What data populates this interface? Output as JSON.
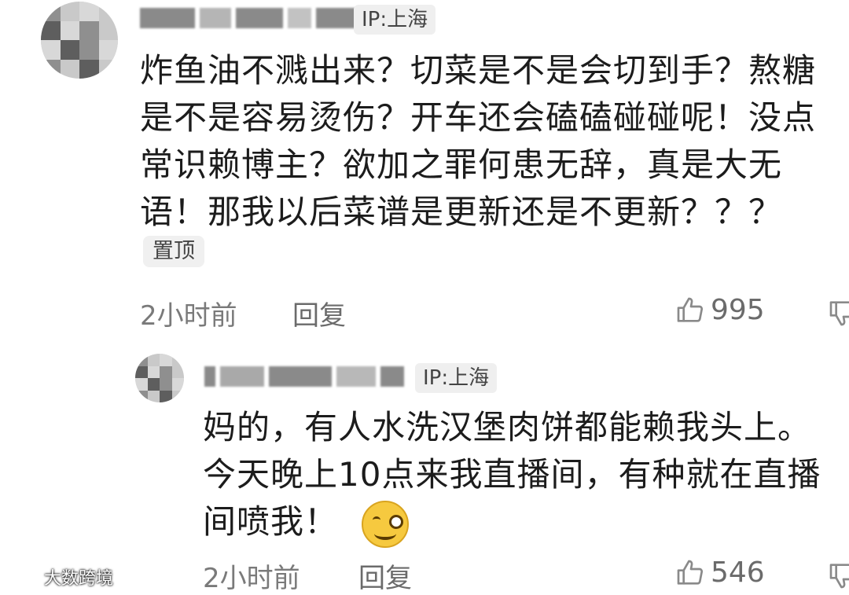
{
  "comment": {
    "ip": "IP:上海",
    "text_lines": [
      "炸鱼油不溅出来？切菜是不是会切到手？熬糖",
      "是不是容易烫伤？开车还会磕磕碰碰呢！没点",
      "常识赖博主？欲加之罪何患无辞，真是大无",
      "语！那我以后菜谱是更新还是不更新？？？"
    ],
    "pin_tag": "置顶",
    "time": "2小时前",
    "reply_label": "回复",
    "likes": "995"
  },
  "reply": {
    "ip": "IP:上海",
    "text_lines": [
      "妈的，有人水洗汉堡肉饼都能赖我头上。",
      "今天晚上10点来我直播间，有种就在直播",
      "间喷我！"
    ],
    "time": "2小时前",
    "reply_label": "回复",
    "likes": "546"
  },
  "watermark": "大数跨境",
  "icons": {
    "like": "thumbs-up-icon",
    "dislike": "thumbs-down-icon",
    "emoji": "smirk-emoji-icon"
  }
}
